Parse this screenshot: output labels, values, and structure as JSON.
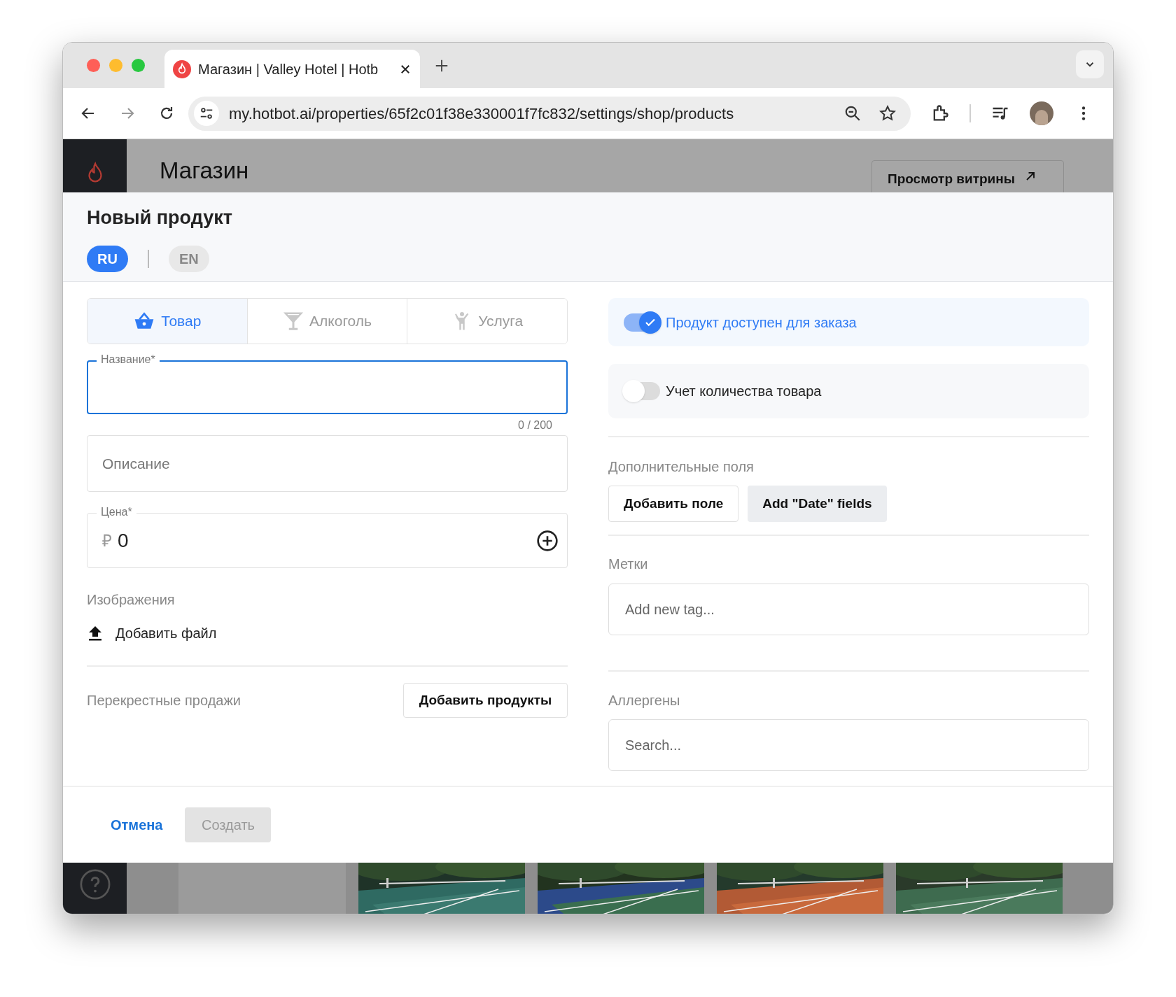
{
  "browser": {
    "tab": {
      "title": "Магазин | Valley Hotel | Hotb"
    },
    "address": "my.hotbot.ai/properties/65f2c01f38e330001f7fc832/settings/shop/products"
  },
  "header": {
    "title": "Магазин",
    "storefront_button": "Просмотр витрины"
  },
  "modal": {
    "title": "Новый продукт",
    "languages": [
      {
        "label": "RU",
        "selected": true
      },
      {
        "label": "EN",
        "selected": false
      }
    ],
    "type_tabs": [
      {
        "kind": "basket",
        "label": "Товар",
        "selected": true
      },
      {
        "kind": "glass",
        "label": "Алкоголь",
        "selected": false
      },
      {
        "kind": "person",
        "label": "Услуга",
        "selected": false
      }
    ],
    "name_field": {
      "label": "Название*",
      "focused": true,
      "counter": "0 / 200"
    },
    "description_field": {
      "placeholder": "Описание"
    },
    "price_field": {
      "label": "Цена*",
      "currency": "₽",
      "value": "0"
    },
    "images": {
      "label": "Изображения",
      "add_button": "Добавить файл"
    },
    "cross_sales": {
      "label": "Перекрестные продажи",
      "button": "Добавить продукты"
    },
    "toggles": [
      {
        "label": "Продукт доступен для заказа",
        "on": true
      },
      {
        "label": "Учет количества товара",
        "on": false
      }
    ],
    "extra_fields": {
      "label": "Дополнительные поля",
      "buttons": [
        {
          "label": "Добавить поле",
          "kind": "outline"
        },
        {
          "label": "Add \"Date\" fields",
          "kind": "filled"
        }
      ]
    },
    "tags": {
      "label": "Метки",
      "placeholder": "Add new tag..."
    },
    "allergens": {
      "label": "Аллергены",
      "placeholder": "Search..."
    },
    "footer": {
      "cancel": "Отмена",
      "create": {
        "label": "Создать",
        "disabled": true
      }
    }
  }
}
